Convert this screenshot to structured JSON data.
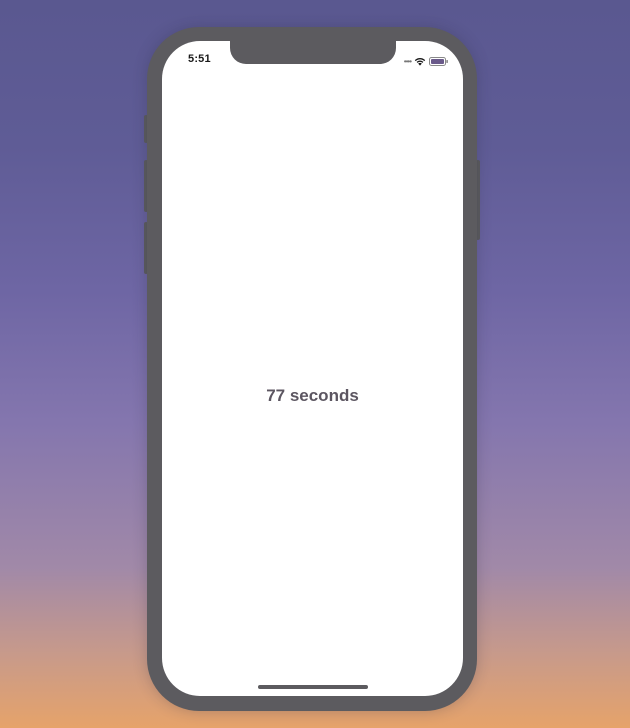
{
  "status_bar": {
    "time": "5:51",
    "signal_icon": "cellular-signal-dots",
    "wifi_icon": "wifi",
    "battery_icon": "battery"
  },
  "main": {
    "timer_text": "77 seconds"
  },
  "colors": {
    "frame": "#5c5b5f",
    "screen": "#ffffff",
    "text": "#5c5661",
    "bg_top": "#5a5890",
    "bg_bottom": "#e6a36a"
  }
}
